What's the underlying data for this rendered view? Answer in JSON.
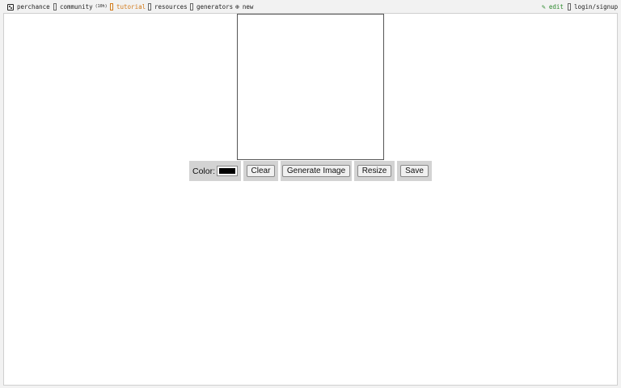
{
  "nav": {
    "brand": "perchance",
    "community": "community",
    "community_count": "(10h)",
    "tutorial": "tutorial",
    "resources": "resources",
    "generators": "generators",
    "new": "new",
    "edit": "edit",
    "login": "login/signup"
  },
  "icons": {
    "brand": "dice-icon",
    "community": "chat-icon",
    "tutorial": "book-icon",
    "resources": "book-icon",
    "generators": "grid-icon",
    "new": "plus-circle-icon",
    "edit": "pencil-icon",
    "login": "user-icon"
  },
  "toolbar": {
    "color_label": "Color:",
    "color_value": "#000000",
    "clear_label": "Clear",
    "generate_label": "Generate Image",
    "resize_label": "Resize",
    "save_label": "Save"
  },
  "colors": {
    "tutorial": "#d27a1a",
    "edit": "#2d8a2d",
    "control_bg": "#d3d3d3"
  }
}
